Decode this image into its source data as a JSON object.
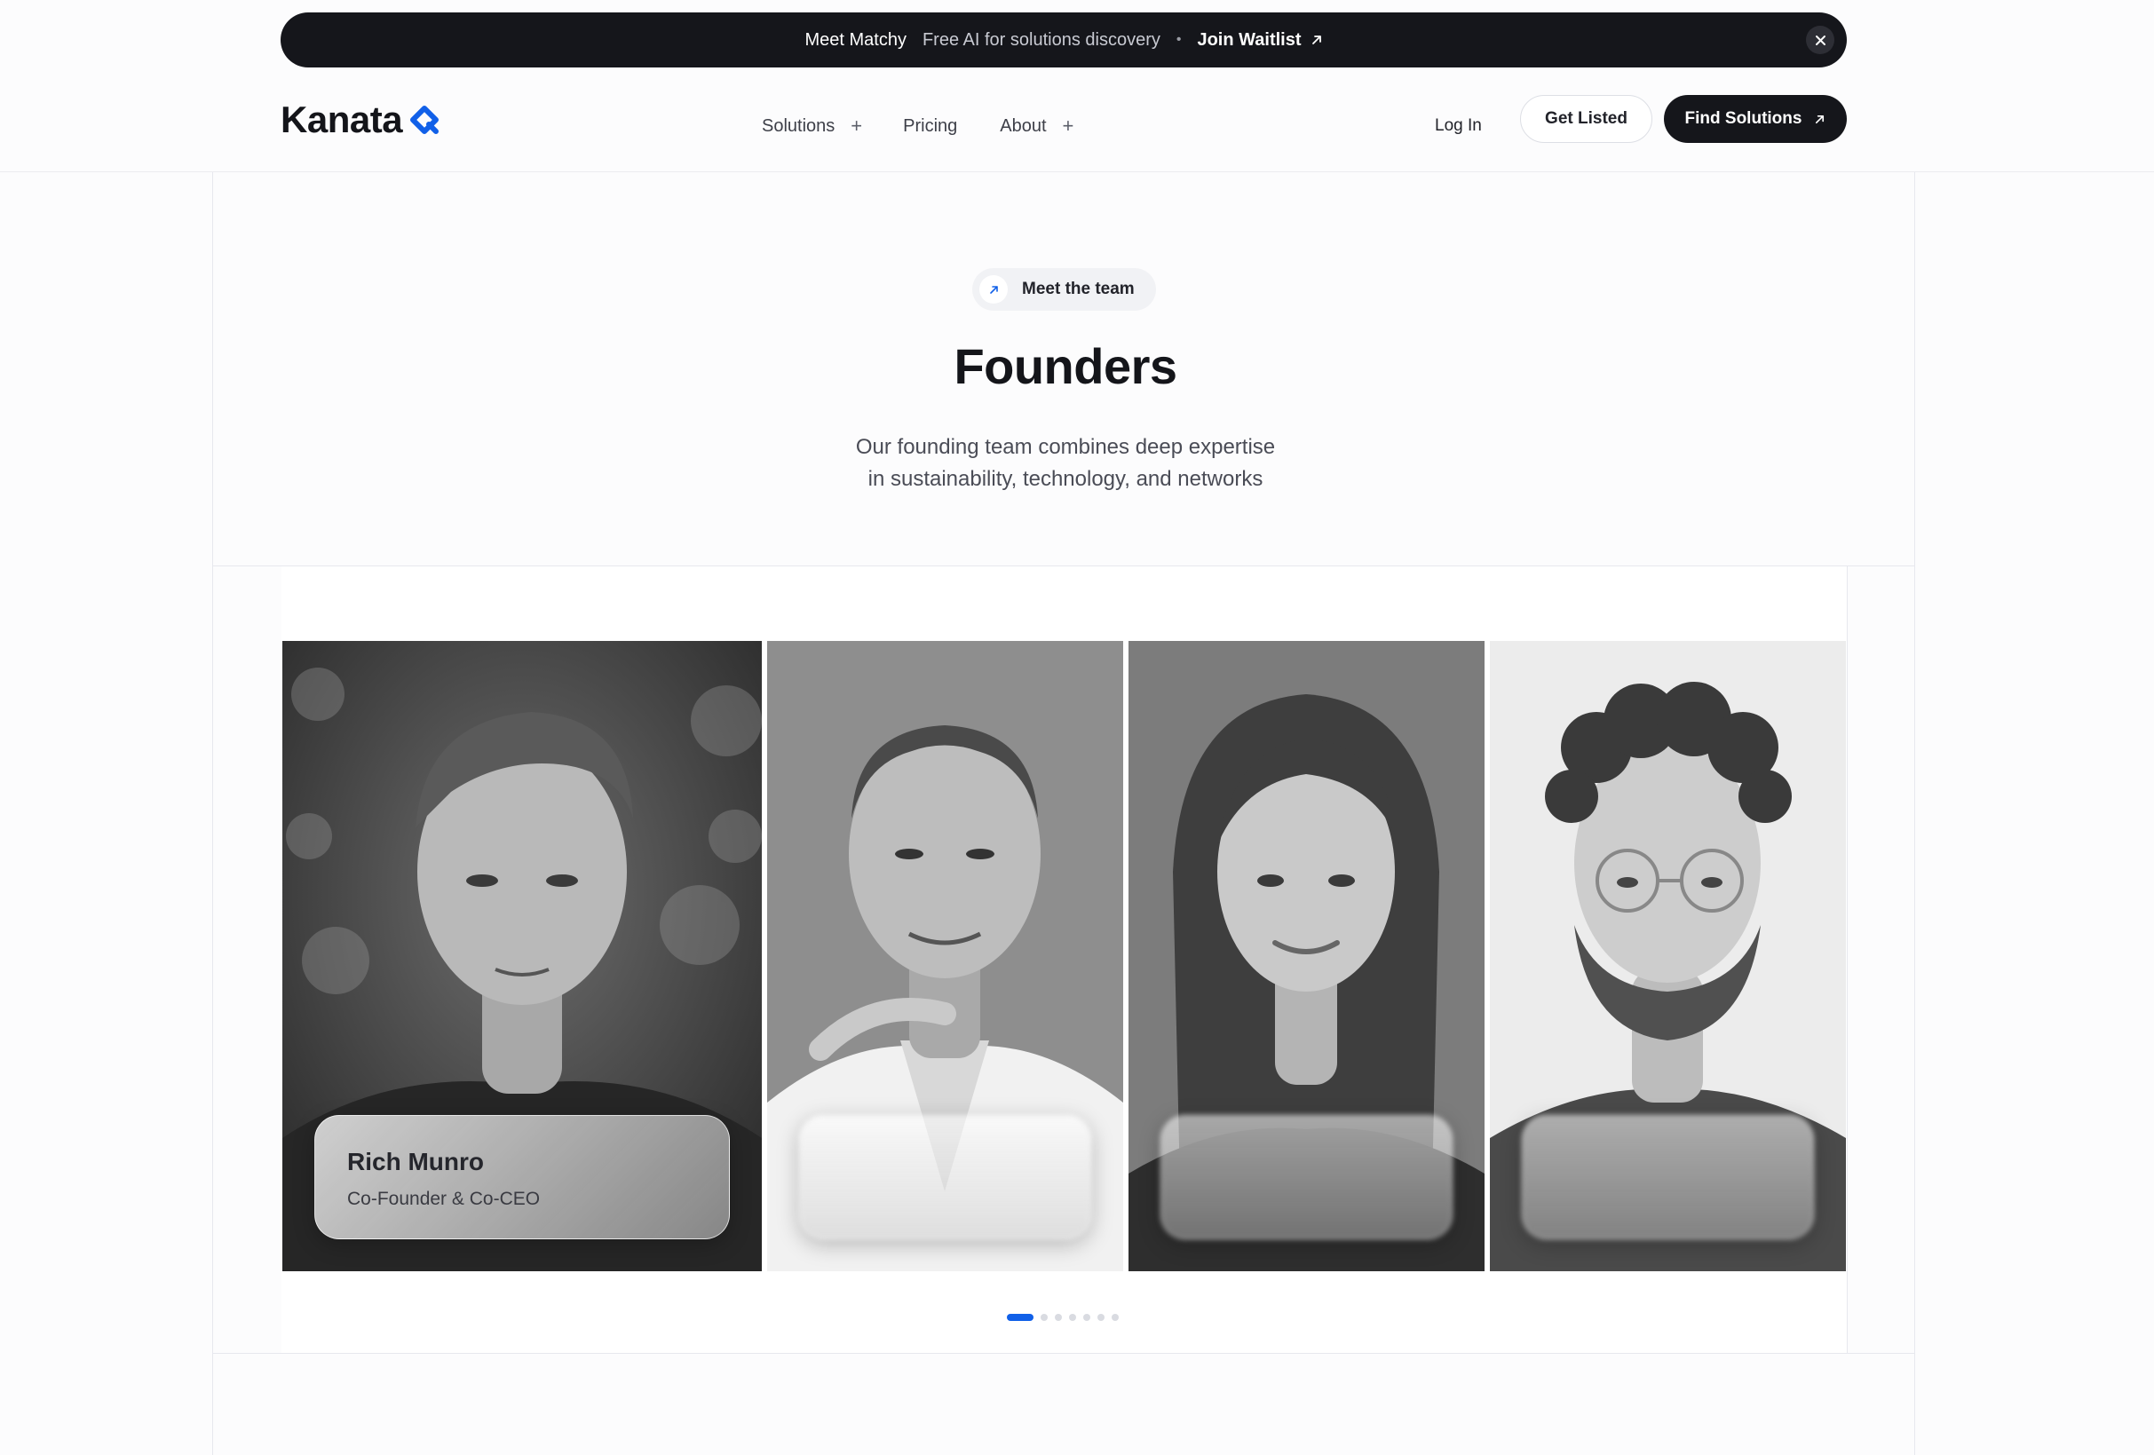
{
  "announcement": {
    "title": "Meet Matchy",
    "text": "Free AI for solutions discovery",
    "separator": "•",
    "link_label": "Join Waitlist"
  },
  "header": {
    "logo_text": "Kanata",
    "nav": [
      {
        "label": "Solutions",
        "has_submenu": true
      },
      {
        "label": "Pricing",
        "has_submenu": false
      },
      {
        "label": "About",
        "has_submenu": true
      }
    ],
    "login_label": "Log In",
    "get_listed_label": "Get Listed",
    "find_solutions_label": "Find Solutions"
  },
  "hero": {
    "pill_label": "Meet the team",
    "title": "Founders",
    "subtitle_line1": "Our founding team combines deep expertise",
    "subtitle_line2": "in sustainability, technology, and networks"
  },
  "founders": [
    {
      "name": "Rich Munro",
      "role": "Co-Founder & Co-CEO"
    }
  ],
  "carousel": {
    "total_slides": 7,
    "active_slide": 1
  },
  "colors": {
    "brand_blue": "#1160e8",
    "dark": "#15161b",
    "background": "#fcfcfd"
  }
}
